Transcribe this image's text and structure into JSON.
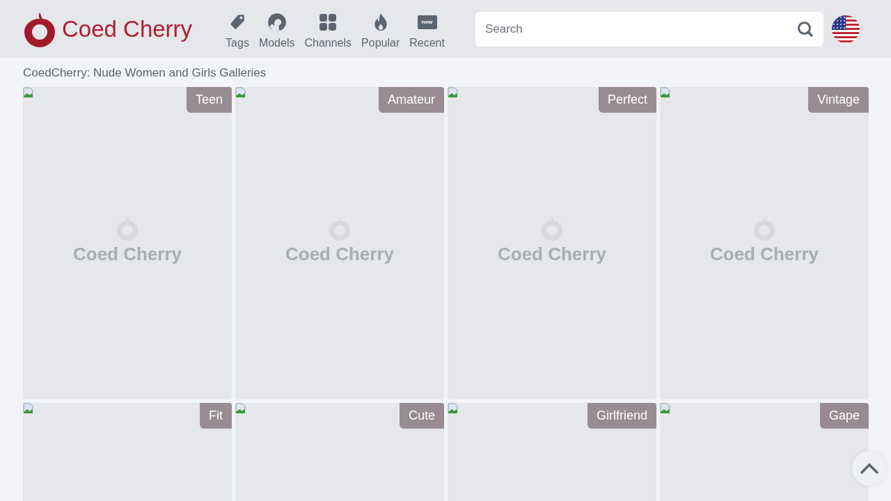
{
  "header": {
    "logo": "Coed Cherry",
    "nav": [
      {
        "label": "Tags",
        "kind": "tag"
      },
      {
        "label": "Models",
        "kind": "model"
      },
      {
        "label": "Channels",
        "kind": "grid"
      },
      {
        "label": "Popular",
        "kind": "flame"
      },
      {
        "label": "Recent",
        "kind": "new",
        "badge": "new"
      }
    ],
    "search": {
      "placeholder": "Search"
    }
  },
  "page_title": "CoedCherry: Nude Women and Girls Galleries",
  "columns": [
    [
      {
        "tag": "Teen",
        "placeholder": "Coed Cherry"
      },
      {
        "tag": "Fit"
      }
    ],
    [
      {
        "tag": "Amateur",
        "placeholder": "Coed Cherry"
      },
      {
        "tag": "Cute"
      }
    ],
    [
      {
        "tag": "Perfect",
        "placeholder": "Coed Cherry"
      },
      {
        "tag": "Girlfriend"
      }
    ],
    [
      {
        "tag": "Vintage",
        "placeholder": "Coed Cherry"
      },
      {
        "tag": "Gape"
      }
    ]
  ]
}
